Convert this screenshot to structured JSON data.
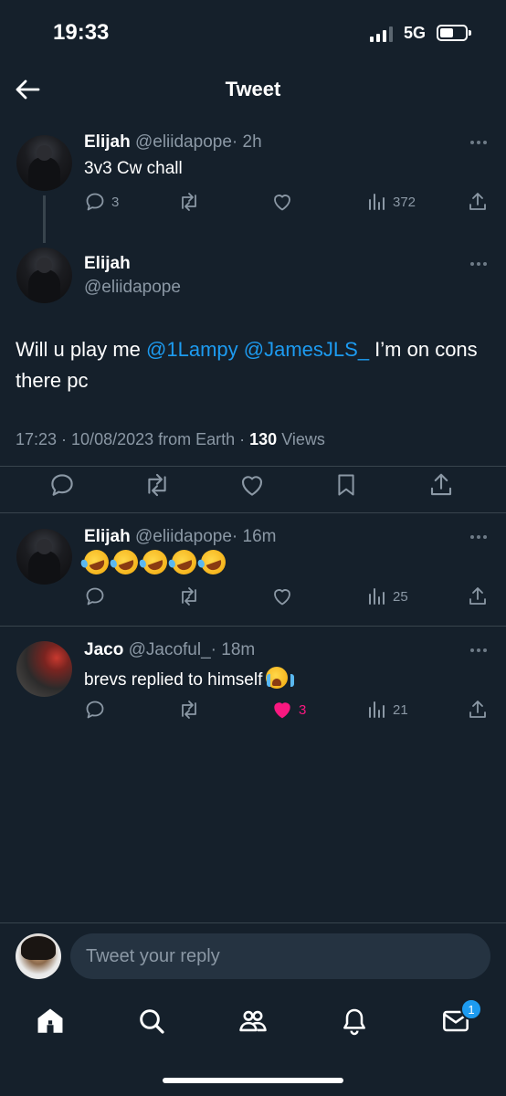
{
  "status_bar": {
    "time": "19:33",
    "network": "5G"
  },
  "header": {
    "title": "Tweet"
  },
  "parent_tweet": {
    "name": "Elijah",
    "handle": "@eliidapope",
    "time": "· 2h",
    "text": "3v3 Cw chall",
    "replies": "3",
    "views": "372"
  },
  "main_tweet": {
    "name": "Elijah",
    "handle": "@eliidapope",
    "text_before": "Will u play me ",
    "mention1": "@1Lampy",
    "mention2": "@JamesJLS_",
    "text_after": " I’m on cons there pc",
    "timestamp": "17:23 · 10/08/2023 from Earth · ",
    "views_count": "130",
    "views_label": " Views"
  },
  "replies": [
    {
      "name": "Elijah",
      "handle": "@eliidapope",
      "time": "· 16m",
      "emoji_count": 5,
      "views": "25"
    },
    {
      "name": "Jaco",
      "handle": "@Jacoful_",
      "time": "· 18m",
      "text": "brevs replied to himself",
      "likes": "3",
      "views": "21"
    }
  ],
  "reply_box": {
    "placeholder": "Tweet your reply"
  },
  "bottom_nav": {
    "messages_badge": "1"
  },
  "colors": {
    "background": "#15202b",
    "accent": "#1d9bf0",
    "like": "#f91880",
    "muted": "#8b98a5"
  },
  "icons": [
    "back-arrow-icon",
    "reply-icon",
    "retweet-icon",
    "like-icon",
    "views-icon",
    "share-icon",
    "bookmark-icon",
    "home-icon",
    "search-icon",
    "communities-icon",
    "notifications-icon",
    "messages-icon"
  ]
}
